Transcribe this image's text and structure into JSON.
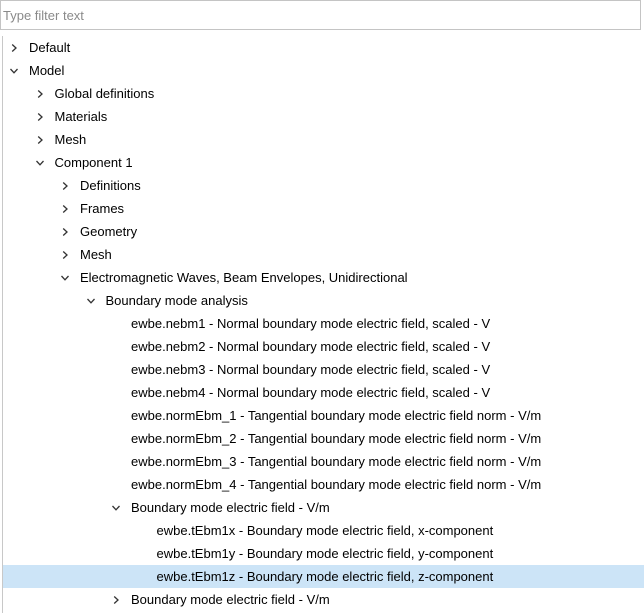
{
  "filter": {
    "placeholder": "Type filter text",
    "value": ""
  },
  "tree": [
    {
      "label": "Default",
      "level": 0,
      "expander": "collapsed"
    },
    {
      "label": "Model",
      "level": 0,
      "expander": "expanded"
    },
    {
      "label": "Global definitions",
      "level": 1,
      "expander": "collapsed"
    },
    {
      "label": "Materials",
      "level": 1,
      "expander": "collapsed"
    },
    {
      "label": "Mesh",
      "level": 1,
      "expander": "collapsed"
    },
    {
      "label": "Component 1",
      "level": 1,
      "expander": "expanded"
    },
    {
      "label": "Definitions",
      "level": 2,
      "expander": "collapsed"
    },
    {
      "label": "Frames",
      "level": 2,
      "expander": "collapsed"
    },
    {
      "label": "Geometry",
      "level": 2,
      "expander": "collapsed"
    },
    {
      "label": "Mesh",
      "level": 2,
      "expander": "collapsed"
    },
    {
      "label": "Electromagnetic Waves, Beam Envelopes, Unidirectional",
      "level": 2,
      "expander": "expanded"
    },
    {
      "label": "Boundary mode analysis",
      "level": 3,
      "expander": "expanded"
    },
    {
      "label": "ewbe.nebm1 - Normal boundary mode electric field, scaled - V",
      "level": 4,
      "expander": "none"
    },
    {
      "label": "ewbe.nebm2 - Normal boundary mode electric field, scaled - V",
      "level": 4,
      "expander": "none"
    },
    {
      "label": "ewbe.nebm3 - Normal boundary mode electric field, scaled - V",
      "level": 4,
      "expander": "none"
    },
    {
      "label": "ewbe.nebm4 - Normal boundary mode electric field, scaled - V",
      "level": 4,
      "expander": "none"
    },
    {
      "label": "ewbe.normEbm_1 - Tangential boundary mode electric field norm - V/m",
      "level": 4,
      "expander": "none"
    },
    {
      "label": "ewbe.normEbm_2 - Tangential boundary mode electric field norm - V/m",
      "level": 4,
      "expander": "none"
    },
    {
      "label": "ewbe.normEbm_3 - Tangential boundary mode electric field norm - V/m",
      "level": 4,
      "expander": "none"
    },
    {
      "label": "ewbe.normEbm_4 - Tangential boundary mode electric field norm - V/m",
      "level": 4,
      "expander": "none"
    },
    {
      "label": "Boundary mode electric field - V/m",
      "level": 4,
      "expander": "expanded"
    },
    {
      "label": "ewbe.tEbm1x - Boundary mode electric field, x-component",
      "level": 5,
      "expander": "none"
    },
    {
      "label": "ewbe.tEbm1y - Boundary mode electric field, y-component",
      "level": 5,
      "expander": "none"
    },
    {
      "label": "ewbe.tEbm1z - Boundary mode electric field, z-component",
      "level": 5,
      "expander": "none",
      "selected": true
    },
    {
      "label": "Boundary mode electric field - V/m",
      "level": 4,
      "expander": "collapsed"
    }
  ],
  "colors": {
    "selection": "#cce4f7",
    "chevron": "#333333",
    "border": "#c8c8c8"
  }
}
